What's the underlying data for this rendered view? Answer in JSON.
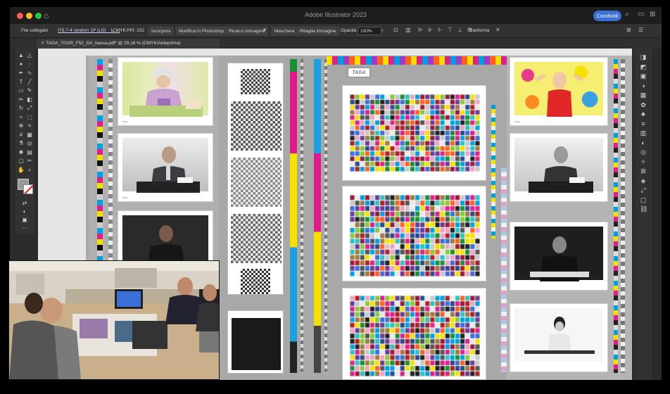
{
  "window": {
    "title": "Adobe Illustrator 2023",
    "share_label": "Condividi"
  },
  "controlbar": {
    "linked_file": "File collegato",
    "file_name": "IT8.7-4 random 1P (LIO__L_...",
    "color_mode": "CMYK",
    "ppi_label": "PPI: 102",
    "embed": "Incorpora",
    "edit_photoshop": "Modifica in Photoshop",
    "image_trace": "Ricalco immagine",
    "mask": "Maschera",
    "crop_image": "Ritaglia immagine",
    "opacity_label": "Opacità",
    "opacity_value": "100%",
    "transform": "Trasforma"
  },
  "document": {
    "tab_title": "TAGA_70100_F52_DA_bassa.pdf* @ 29,16 % (CMYK/Anteprima)"
  },
  "colors": {
    "share_blue": "#3a6fd8",
    "panel": "#323232",
    "canvas": "#e6e6e6",
    "fill_swatch": "#9a9a9a",
    "stroke_slash": "#e02020"
  },
  "artwork": {
    "logo_text": "TAGA"
  },
  "icons": {
    "home": "home-icon",
    "search": "search-icon",
    "layout": "layout-icon",
    "arrange": "arrange-icon",
    "align": "align-icon",
    "transform": "transform-icon",
    "tools": [
      "selection-arrow-icon",
      "direct-selection-icon",
      "magic-wand-icon",
      "lasso-icon",
      "pen-icon",
      "curvature-icon",
      "type-icon",
      "line-icon",
      "rectangle-icon",
      "paintbrush-icon",
      "pencil-icon",
      "eraser-icon",
      "rotate-icon",
      "scale-icon",
      "warp-icon",
      "free-transform-icon",
      "shape-builder-icon",
      "perspective-icon",
      "mesh-icon",
      "gradient-icon",
      "eyedropper-icon",
      "blend-icon",
      "symbol-sprayer-icon",
      "graph-icon",
      "artboard-icon",
      "slice-icon",
      "hand-icon",
      "zoom-icon"
    ],
    "right_panels": [
      "properties-icon",
      "layers-icon",
      "libraries-icon",
      "color-icon",
      "swatches-icon",
      "brushes-icon",
      "symbols-icon",
      "stroke-icon",
      "gradient-panel-icon",
      "transparency-icon",
      "appearance-icon",
      "graphic-styles-icon",
      "align-panel-icon",
      "pathfinder-icon",
      "transform-panel-icon",
      "artboards-icon",
      "links-icon"
    ]
  }
}
